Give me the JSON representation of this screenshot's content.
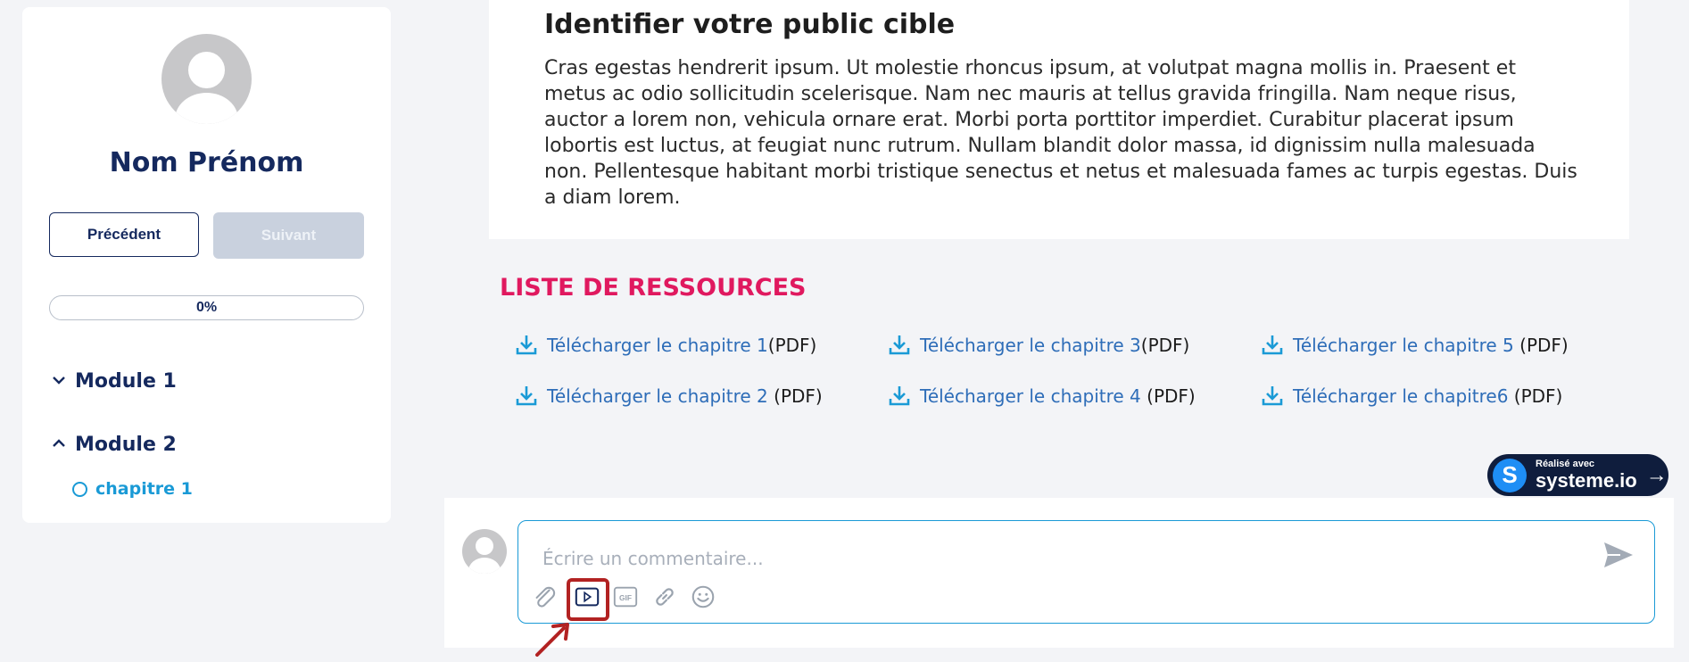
{
  "sidebar": {
    "user_name": "Nom Prénom",
    "prev_label": "Précédent",
    "next_label": "Suivant",
    "progress_label": "0%",
    "progress_value": 0,
    "modules": [
      {
        "label": "Module 1",
        "expanded": false
      },
      {
        "label": "Module 2",
        "expanded": true
      }
    ],
    "chapter_label": "chapitre 1"
  },
  "content": {
    "title": "Identifier votre public cible",
    "body": "Cras egestas hendrerit ipsum. Ut molestie rhoncus ipsum, at volutpat magna mollis in. Praesent et metus ac odio sollicitudin scelerisque. Nam nec mauris at tellus gravida fringilla. Nam neque risus, auctor a lorem non, vehicula ornare erat. Morbi porta porttitor imperdiet. Curabitur placerat ipsum lobortis est luctus, at feugiat nunc rutrum. Nullam blandit dolor massa, id dignissim nulla malesuada non. Pellentesque habitant morbi tristique senectus et netus et malesuada fames ac turpis egestas. Duis a diam lorem."
  },
  "resources": {
    "title": "LISTE DE RESSOURCES",
    "items": [
      {
        "link": "Télécharger le chapitre 1",
        "suffix": "(PDF)"
      },
      {
        "link": "Télécharger le chapitre 3",
        "suffix": "(PDF)"
      },
      {
        "link": "Télécharger le chapitre 5",
        "suffix": " (PDF)"
      },
      {
        "link": "Télécharger le chapitre 2",
        "suffix": " (PDF)"
      },
      {
        "link": "Télécharger le chapitre 4",
        "suffix": " (PDF)"
      },
      {
        "link": "Télécharger le chapitre6",
        "suffix": " (PDF)"
      }
    ]
  },
  "badge": {
    "small": "Réalisé avec",
    "big": "systeme.io",
    "logo_letter": "S"
  },
  "comment": {
    "placeholder": "Écrire un commentaire...",
    "gif_label": "GIF"
  },
  "colors": {
    "navy": "#15295e",
    "accent_blue": "#1a9ad6",
    "link_blue": "#2e6db8",
    "pink": "#e0195f",
    "highlight_red": "#b22222"
  }
}
